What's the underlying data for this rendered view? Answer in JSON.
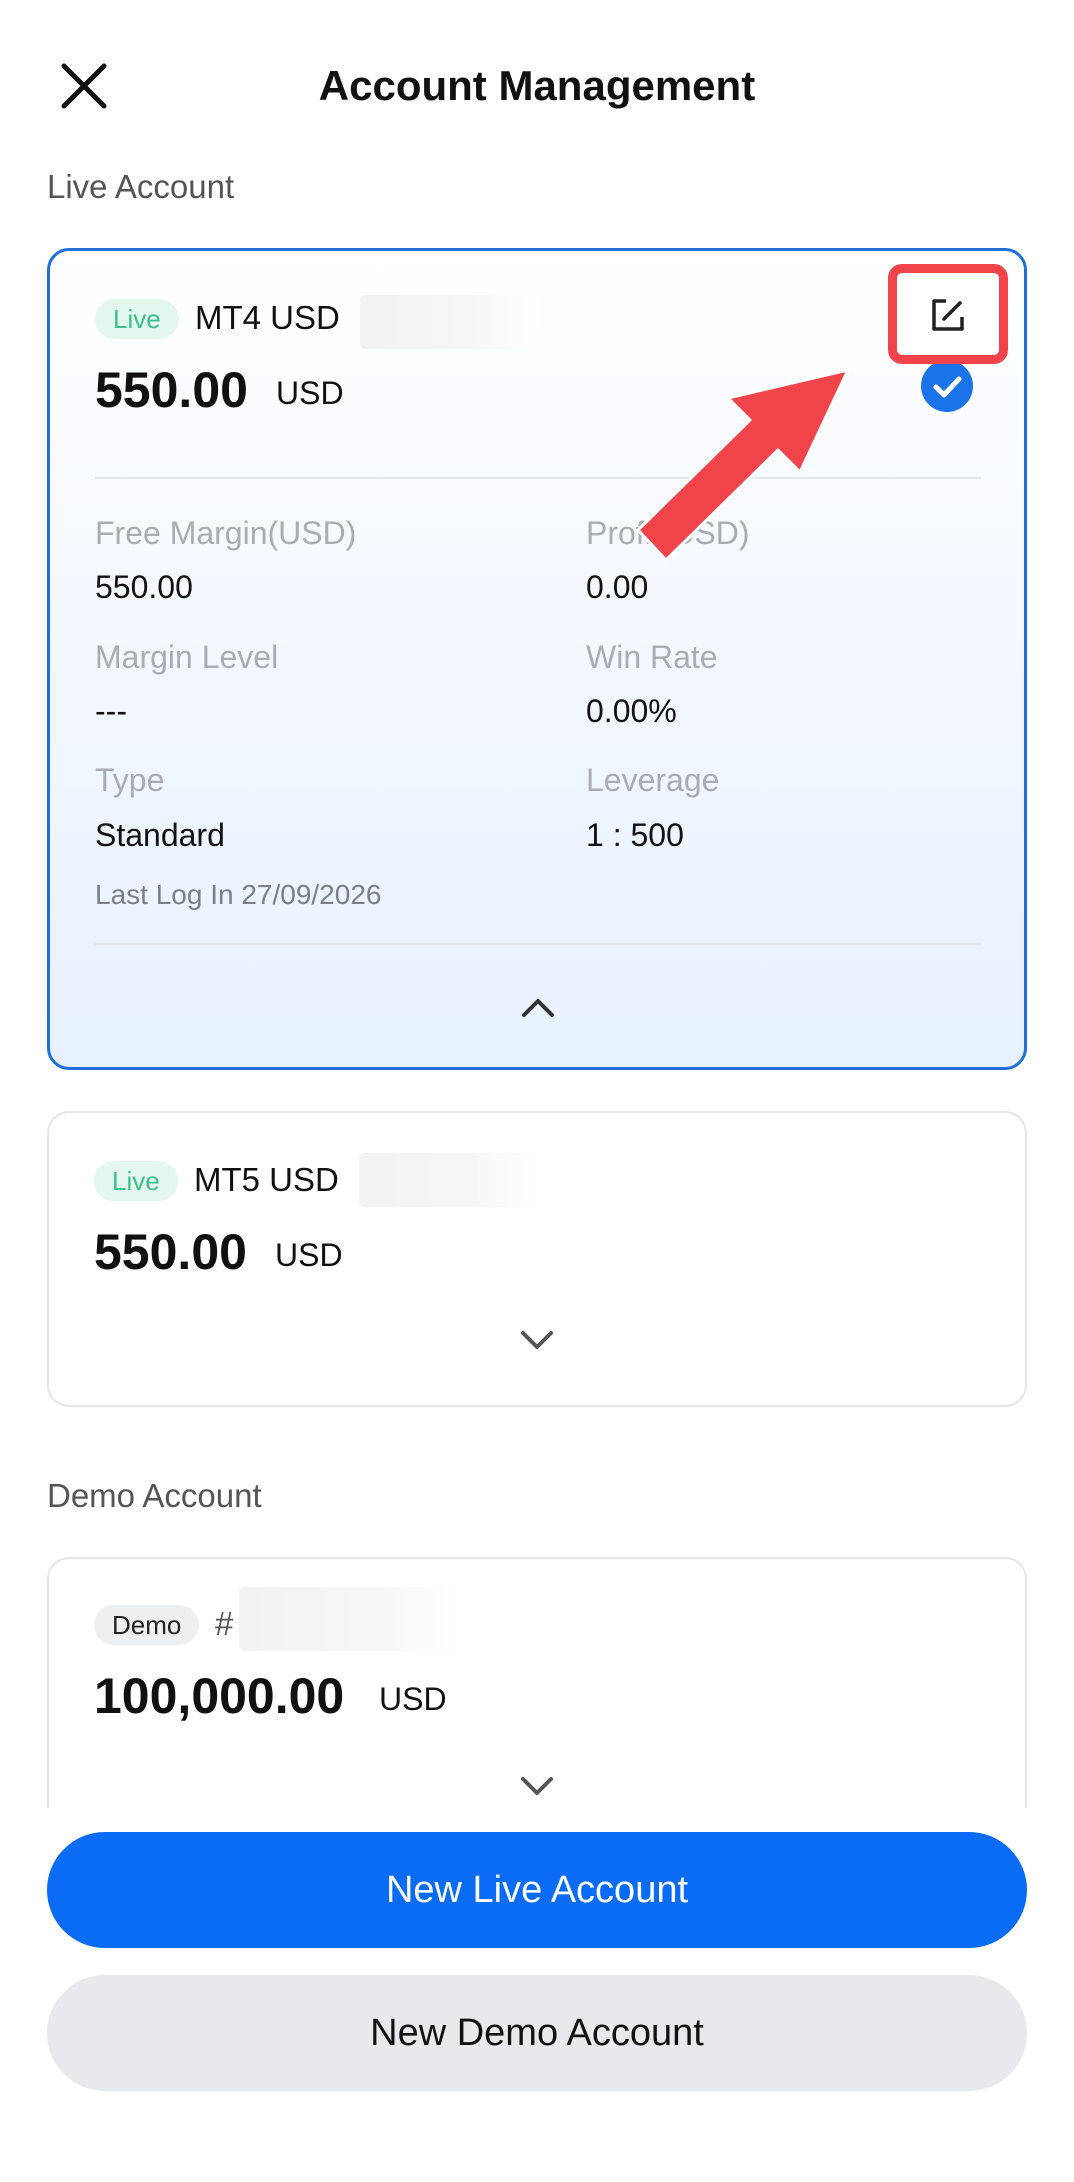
{
  "header": {
    "title": "Account Management",
    "close_icon": "close-icon"
  },
  "sections": {
    "live": "Live Account",
    "demo": "Demo Account"
  },
  "accounts": [
    {
      "badge": "Live",
      "name": "MT4 USD",
      "balance": "550.00",
      "currency": "USD",
      "selected": true,
      "stats": {
        "free_margin_label": "Free Margin(USD)",
        "free_margin": "550.00",
        "profit_label": "Profit(USD)",
        "profit": "0.00",
        "margin_level_label": "Margin Level",
        "margin_level": "---",
        "win_rate_label": "Win Rate",
        "win_rate": "0.00%",
        "type_label": "Type",
        "type": "Standard",
        "leverage_label": "Leverage",
        "leverage": "1 : 500"
      },
      "last_login": "Last Log In 27/09/2026"
    },
    {
      "badge": "Live",
      "name": "MT5 USD",
      "balance": "550.00",
      "currency": "USD",
      "selected": false
    },
    {
      "badge": "Demo",
      "name": "#",
      "balance": "100,000.00",
      "currency": "USD",
      "selected": false
    }
  ],
  "buttons": {
    "new_live": "New Live Account",
    "new_demo": "New Demo Account"
  },
  "colors": {
    "accent": "#0a6cf5",
    "active_border": "#1e6fd9",
    "highlight_red": "#f0444a",
    "live_badge_text": "#3dbf8a"
  }
}
